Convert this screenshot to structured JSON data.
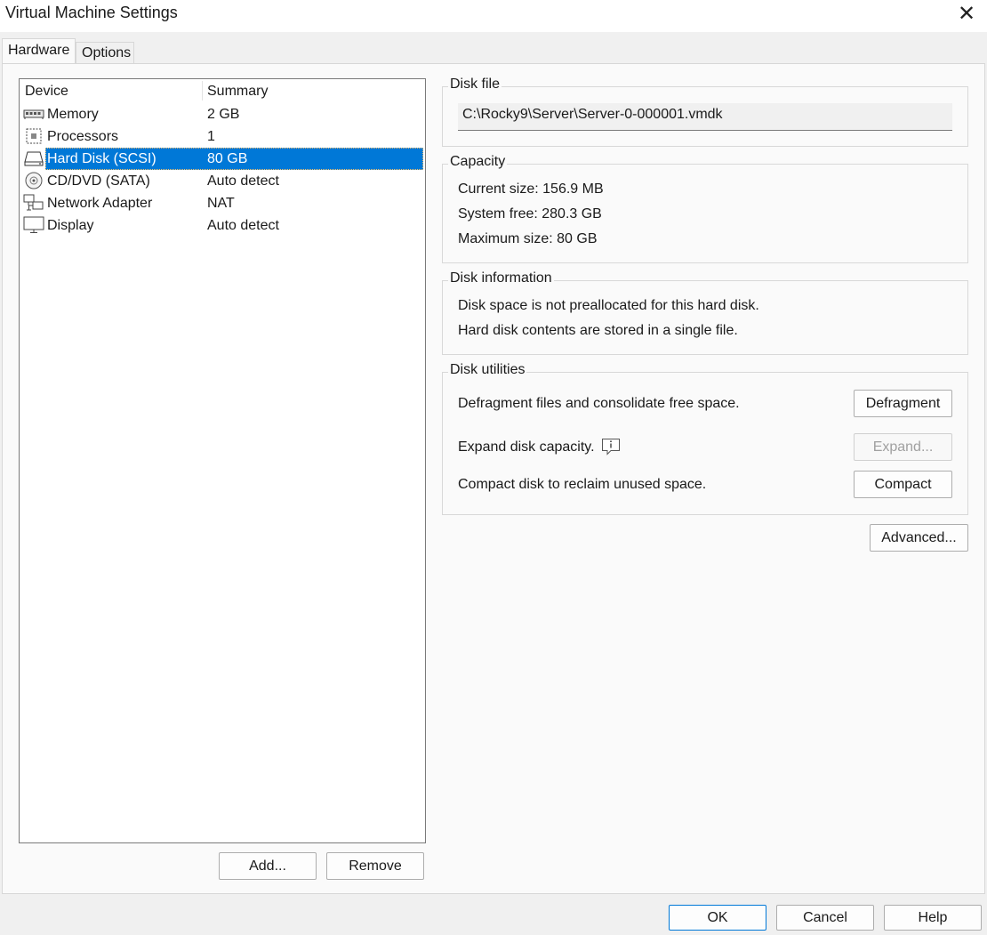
{
  "window": {
    "title": "Virtual Machine Settings",
    "close_glyph": "✕"
  },
  "tabs": [
    {
      "label": "Hardware",
      "active": true
    },
    {
      "label": "Options",
      "active": false
    }
  ],
  "device_list": {
    "columns": {
      "device": "Device",
      "summary": "Summary"
    },
    "rows": [
      {
        "device": "Memory",
        "summary": "2 GB",
        "icon": "memory-icon"
      },
      {
        "device": "Processors",
        "summary": "1",
        "icon": "processor-icon"
      },
      {
        "device": "Hard Disk (SCSI)",
        "summary": "80 GB",
        "icon": "hard-disk-icon",
        "selected": true
      },
      {
        "device": "CD/DVD (SATA)",
        "summary": "Auto detect",
        "icon": "cd-dvd-icon"
      },
      {
        "device": "Network Adapter",
        "summary": "NAT",
        "icon": "network-adapter-icon"
      },
      {
        "device": "Display",
        "summary": "Auto detect",
        "icon": "display-icon"
      }
    ],
    "add_label": "Add...",
    "remove_label": "Remove"
  },
  "disk_file": {
    "title": "Disk file",
    "path": "C:\\Rocky9\\Server\\Server-0-000001.vmdk"
  },
  "capacity": {
    "title": "Capacity",
    "current_size": "Current size: 156.9 MB",
    "system_free": "System free: 280.3 GB",
    "maximum_size": "Maximum size: 80 GB"
  },
  "disk_information": {
    "title": "Disk information",
    "line1": "Disk space is not preallocated for this hard disk.",
    "line2": "Hard disk contents are stored in a single file."
  },
  "disk_utilities": {
    "title": "Disk utilities",
    "defragment_text": "Defragment files and consolidate free space.",
    "defragment_label": "Defragment",
    "expand_text": "Expand disk capacity.",
    "expand_label": "Expand...",
    "compact_text": "Compact disk to reclaim unused space.",
    "compact_label": "Compact"
  },
  "advanced_label": "Advanced...",
  "footer": {
    "ok_label": "OK",
    "cancel_label": "Cancel",
    "help_label": "Help"
  },
  "colors": {
    "selection": "#0078d7",
    "panel_bg": "#fafafa",
    "window_bg": "#f0f0f0"
  }
}
